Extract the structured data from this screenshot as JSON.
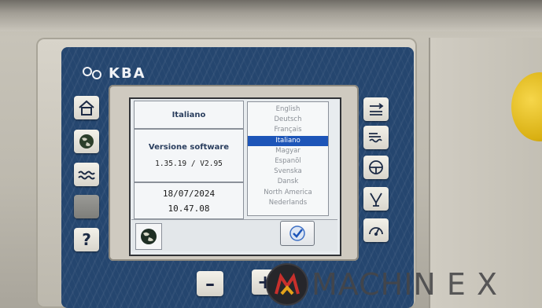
{
  "brand": {
    "name": "KBA"
  },
  "screen": {
    "language_label": "Italiano",
    "software_version_title": "Versione software",
    "software_version": "1.35.19 / V2.95",
    "date": "18/07/2024",
    "time": "10.47.08",
    "languages": [
      {
        "label": "English",
        "selected": false
      },
      {
        "label": "Deutsch",
        "selected": false
      },
      {
        "label": "Français",
        "selected": false
      },
      {
        "label": "Italiano",
        "selected": true
      },
      {
        "label": "Magyar",
        "selected": false
      },
      {
        "label": "Espanõl",
        "selected": false
      },
      {
        "label": "Svenska",
        "selected": false
      },
      {
        "label": "Dansk",
        "selected": false
      },
      {
        "label": "North America",
        "selected": false
      },
      {
        "label": "Nederlands",
        "selected": false
      }
    ]
  },
  "left_keys": [
    "home-icon",
    "globe-icon",
    "water-waves-icon",
    "blank-key",
    "help-icon"
  ],
  "right_keys": [
    "sheet-transfer-icon",
    "dampening-icon",
    "steering-wheel-icon",
    "press-adjust-icon",
    "gauge-icon"
  ],
  "bottom_keys": {
    "minus": "–",
    "plus": "+"
  },
  "help_glyph": "?",
  "watermark": {
    "text": "MACHIN E X"
  },
  "colors": {
    "panel_blue": "#25466f",
    "selection_blue": "#1d55b8",
    "knob_yellow": "#e8c21f"
  }
}
